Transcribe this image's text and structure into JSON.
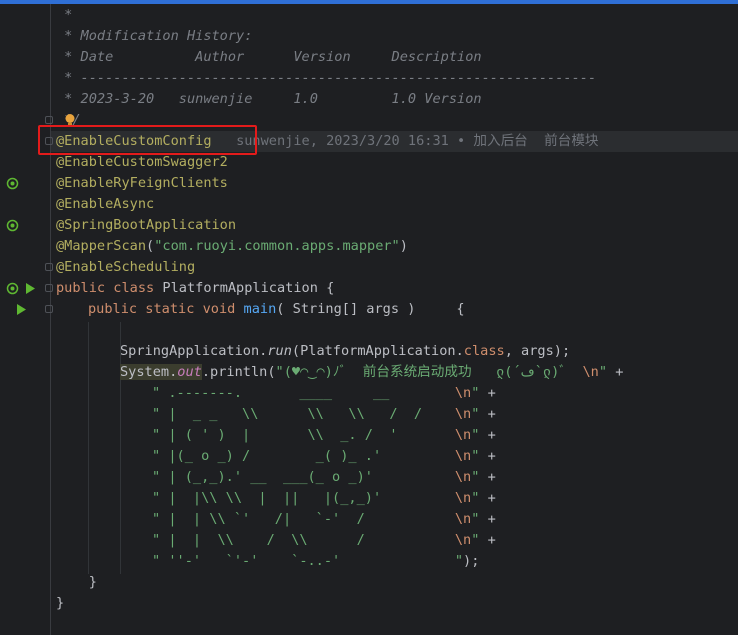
{
  "comment": {
    "l1": " *",
    "l2": " * Modification History:",
    "l3": " * Date          Author      Version     Description",
    "l4": " * ---------------------------------------------------------------",
    "l5": " * 2023-3-20   sunwenjie     1.0         1.0 Version",
    "l6": " */"
  },
  "annotations": {
    "a1": "@EnableCustomConfig",
    "a2": "@EnableCustomSwagger2",
    "a3": "@EnableRyFeignClients",
    "a4": "@EnableAsync",
    "a5": "@SpringBootApplication",
    "a6": "@MapperScan",
    "a6_open": "(",
    "a6_str": "\"com.ruoyi.common.apps.mapper\"",
    "a6_close": ")",
    "a7": "@EnableScheduling"
  },
  "blame": "sunwenjie, 2023/3/20 16:31 • 加入后台  前台模块",
  "class_decl": {
    "kw1": "public",
    "kw2": "class",
    "name": " PlatformApplication {"
  },
  "main_decl": {
    "kw1": "public",
    "kw2": "static",
    "kw3": "void",
    "name": "main",
    "rest": "( String[] args )     {"
  },
  "run_line": {
    "obj": "SpringApplication.",
    "method": "run",
    "open": "(PlatformApplication.",
    "kw": "class",
    "close": ", args);"
  },
  "println_line": {
    "sys": "System.",
    "out": "out",
    "call": ".println(",
    "str": "\"(♥◠‿◠)ﾉﾞ  前台系统启动成功   ლ(´ڡ`ლ)ﾞ  ",
    "esc": "\\n",
    "end": "\" +"
  },
  "ascii": [
    {
      "str": "\" .-------.       ____     __        ",
      "esc": "\\n",
      "end": "\" +"
    },
    {
      "str": "\" |  _ _   \\\\      \\\\   \\\\   /  /    ",
      "esc": "\\n",
      "end": "\" +"
    },
    {
      "str": "\" | ( ' )  |       \\\\  _. /  '       ",
      "esc": "\\n",
      "end": "\" +"
    },
    {
      "str": "\" |(_ o _) /        _( )_ .'         ",
      "esc": "\\n",
      "end": "\" +"
    },
    {
      "str": "\" | (_,_).' __  ___(_ o _)'          ",
      "esc": "\\n",
      "end": "\" +"
    },
    {
      "str": "\" |  |\\\\ \\\\  |  ||   |(_,_)'         ",
      "esc": "\\n",
      "end": "\" +"
    },
    {
      "str": "\" |  | \\\\ `'   /|   `-'  /           ",
      "esc": "\\n",
      "end": "\" +"
    },
    {
      "str": "\" |  |  \\\\    /  \\\\      /           ",
      "esc": "\\n",
      "end": "\" +"
    },
    {
      "str": "\" ''-'   `'-'    `-..-'              ",
      "esc": "",
      "end": "\");"
    }
  ],
  "close_main": "    }",
  "close_class": "}",
  "colors": {
    "background": "#1e1f22",
    "annotation": "#b3ae60",
    "keyword": "#cf8e6d",
    "string": "#6aab73",
    "comment": "#7a7e85",
    "highlight_box": "#e31b1b"
  },
  "icons": {
    "bean": "spring-bean-icon",
    "run": "run-icon",
    "bulb": "lightbulb-icon"
  }
}
